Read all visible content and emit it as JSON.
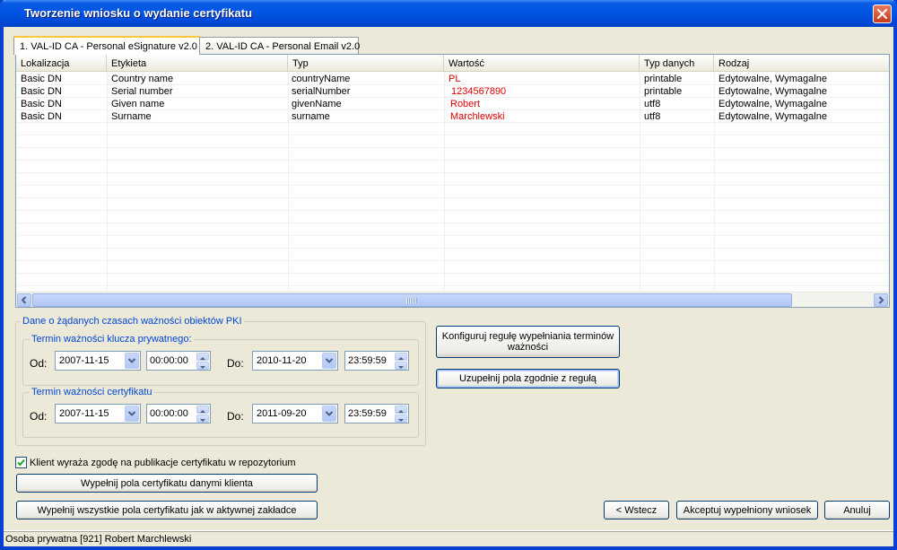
{
  "window": {
    "title": "Tworzenie wniosku o wydanie certyfikatu"
  },
  "tabs": [
    {
      "label": "1. VAL-ID CA - Personal eSignature v2.0",
      "active": true
    },
    {
      "label": "2. VAL-ID CA - Personal Email v2.0",
      "active": false
    }
  ],
  "grid": {
    "columns": [
      "Lokalizacja",
      "Etykieta",
      "Typ",
      "Wartość",
      "Typ danych",
      "Rodzaj"
    ],
    "rows": [
      {
        "loc": "Basic DN",
        "label": "Country name",
        "type": "countryName",
        "value": "PL",
        "dtype": "printable",
        "kind": "Edytowalne, Wymagalne"
      },
      {
        "loc": "Basic DN",
        "label": "Serial number",
        "type": "serialNumber",
        "value": "1234567890",
        "dtype": "printable",
        "kind": "Edytowalne, Wymagalne"
      },
      {
        "loc": "Basic DN",
        "label": "Given name",
        "type": "givenName",
        "value": "Robert",
        "dtype": "utf8",
        "kind": "Edytowalne, Wymagalne"
      },
      {
        "loc": "Basic DN",
        "label": "Surname",
        "type": "surname",
        "value": "Marchlewski",
        "dtype": "utf8",
        "kind": "Edytowalne, Wymagalne"
      }
    ]
  },
  "validity": {
    "title": "Dane o żądanych czasach ważności obiektów PKI",
    "private_key": {
      "title": "Termin ważności klucza prywatnego:",
      "from_label": "Od:",
      "from_date": "2007-11-15",
      "from_time": "00:00:00",
      "to_label": "Do:",
      "to_date": "2010-11-20",
      "to_time": "23:59:59"
    },
    "certificate": {
      "title": "Termin ważności certyfikatu",
      "from_label": "Od:",
      "from_date": "2007-11-15",
      "from_time": "00:00:00",
      "to_label": "Do:",
      "to_date": "2011-09-20",
      "to_time": "23:59:59"
    }
  },
  "buttons": {
    "configure_rule_line1": "Konfiguruj regułę wypełniania terminów",
    "configure_rule_line2": "ważności",
    "fill_by_rule": "Uzupełnij pola zgodnie z regułą",
    "fill_client": "Wypełnij pola certyfikatu danymi klienta",
    "fill_all": "Wypełnij wszystkie pola certyfikatu jak w aktywnej zakładce",
    "back": "< Wstecz",
    "accept": "Akceptuj wypełniony wniosek",
    "cancel": "Anuluj"
  },
  "consent": {
    "label": "Klient wyraża zgodę na publikacje certyfikatu w repozytorium",
    "checked": true
  },
  "status": {
    "text": "Osoba prywatna [921] Robert Marchlewski"
  },
  "colors": {
    "value_text": "#e00000",
    "titlebar": "#0054e3",
    "legend_text": "#0046d5"
  }
}
